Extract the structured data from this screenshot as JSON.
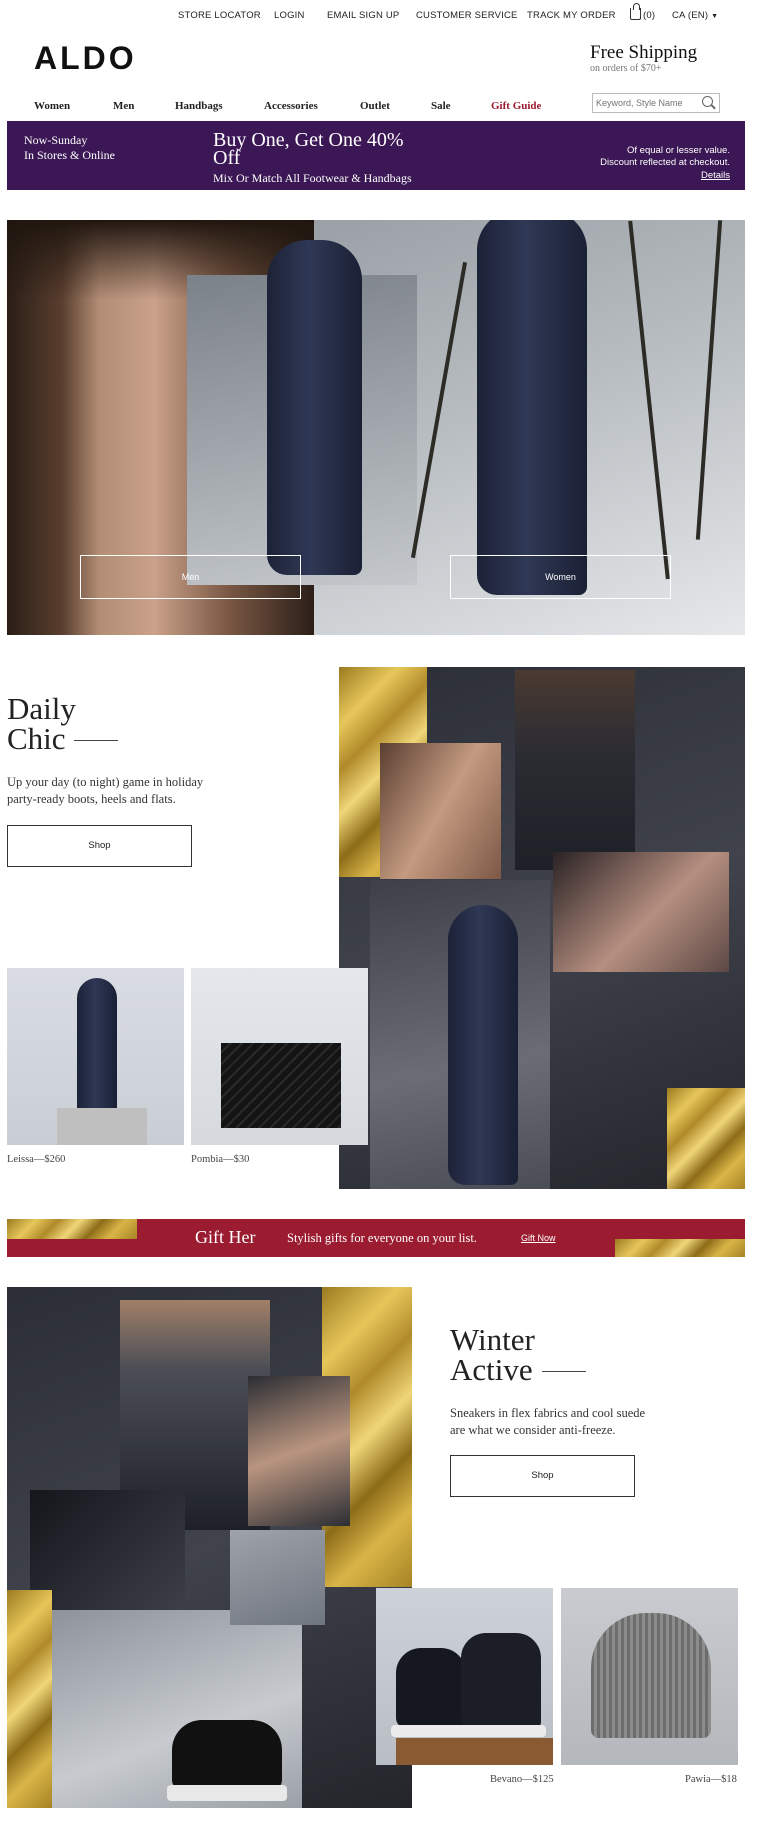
{
  "top_links": {
    "store_locator": "STORE LOCATOR",
    "login": "LOGIN",
    "email_signup": "EMAIL SIGN UP",
    "customer_service": "CUSTOMER SERVICE",
    "track_order": "TRACK MY ORDER",
    "bag_count": "(0)",
    "locale": "CA (EN)"
  },
  "brand": {
    "logo": "ALDO"
  },
  "shipping": {
    "title": "Free Shipping",
    "subtitle": "on orders of $70+"
  },
  "nav": {
    "items": [
      "Women",
      "Men",
      "Handbags",
      "Accessories",
      "Outlet",
      "Sale",
      "Gift Guide"
    ]
  },
  "search": {
    "placeholder": "Keyword, Style Name",
    "icon": "search-icon"
  },
  "promo": {
    "left_line1": "Now-Sunday",
    "left_line2": "In Stores & Online",
    "headline": "Buy One, Get One 40% Off",
    "subline": "Mix Or Match All Footwear & Handbags",
    "right_line1": "Of equal or lesser value.",
    "right_line2": "Discount reflected at checkout.",
    "details": "Details",
    "bg_color": "#3b1855"
  },
  "hero": {
    "men_button": "Men",
    "women_button": "Women"
  },
  "daily_chic": {
    "title_line1": "Daily",
    "title_line2": "Chic",
    "text_line1": "Up your day (to night) game in holiday",
    "text_line2": "party-ready boots, heels and flats.",
    "shop": "Shop",
    "products": [
      {
        "caption": "Leissa—$260"
      },
      {
        "caption": "Pombia—$30"
      }
    ]
  },
  "gift_banner": {
    "title": "Gift Her",
    "text": "Stylish gifts for everyone on your list.",
    "link": "Gift Now",
    "bg_color": "#9b1b30"
  },
  "winter_active": {
    "title_line1": "Winter",
    "title_line2": "Active",
    "text_line1": "Sneakers in flex fabrics and cool suede",
    "text_line2": "are what we consider anti-freeze.",
    "shop": "Shop",
    "products": [
      {
        "caption": "Bevano—$125"
      },
      {
        "caption": "Pawia—$18"
      }
    ]
  }
}
